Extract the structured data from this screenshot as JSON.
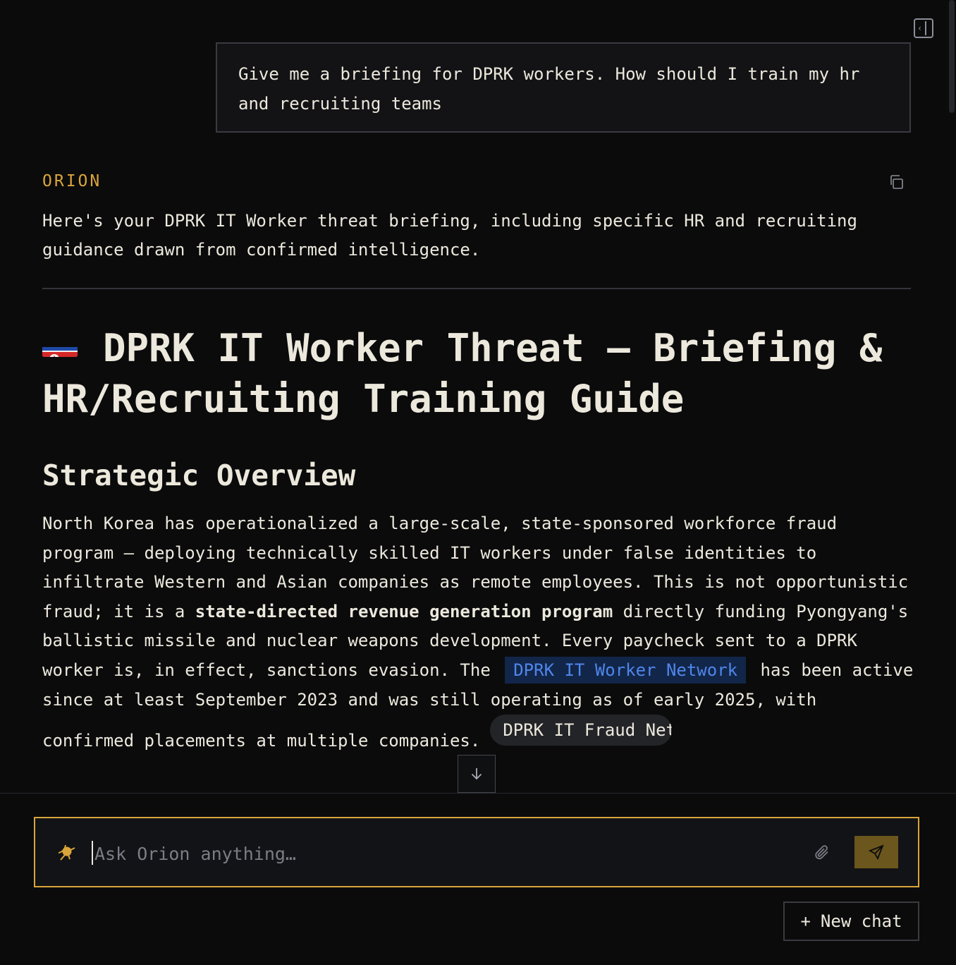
{
  "user_message": "Give me a briefing for DPRK workers. How should I train my hr and recruiting teams",
  "assistant": {
    "name": "ORION",
    "intro": "Here's your DPRK IT Worker threat briefing, including specific HR and recruiting guidance drawn from confirmed intelligence.",
    "title": "DPRK IT Worker Threat — Briefing & HR/Recruiting Training Guide",
    "section_heading": "Strategic Overview",
    "paragraph": {
      "part1": "North Korea has operationalized a large-scale, state-sponsored workforce fraud program — deploying technically skilled IT workers under false identities to infiltrate Western and Asian companies as remote employees. This is not opportunistic fraud; it is a ",
      "bold": "state-directed revenue generation program",
      "part2": " directly funding Pyongyang's ballistic missile and nuclear weapons development. Every paycheck sent to a DPRK worker is, in effect, sanctions evasion. The ",
      "entity_link": "DPRK IT Worker Network",
      "part3": " has been active since at least September 2023 and was still operating as of early 2025, with confirmed placements at multiple companies.",
      "source_chip": "DPRK IT Fraud Net…"
    }
  },
  "composer": {
    "placeholder": "Ask Orion anything…",
    "value": ""
  },
  "new_chat_label": "New chat",
  "colors": {
    "accent": "#d9a53a",
    "background": "#0b0b0c",
    "link": "#4f86ea",
    "link_bg": "#12264a"
  },
  "icons": {
    "collapse": "sidebar-collapse-icon",
    "copy": "copy-icon",
    "scroll_down": "arrow-down-icon",
    "logo": "orion-logo-icon",
    "attach": "paperclip-icon",
    "send": "send-icon",
    "new_chat": "plus-icon"
  }
}
